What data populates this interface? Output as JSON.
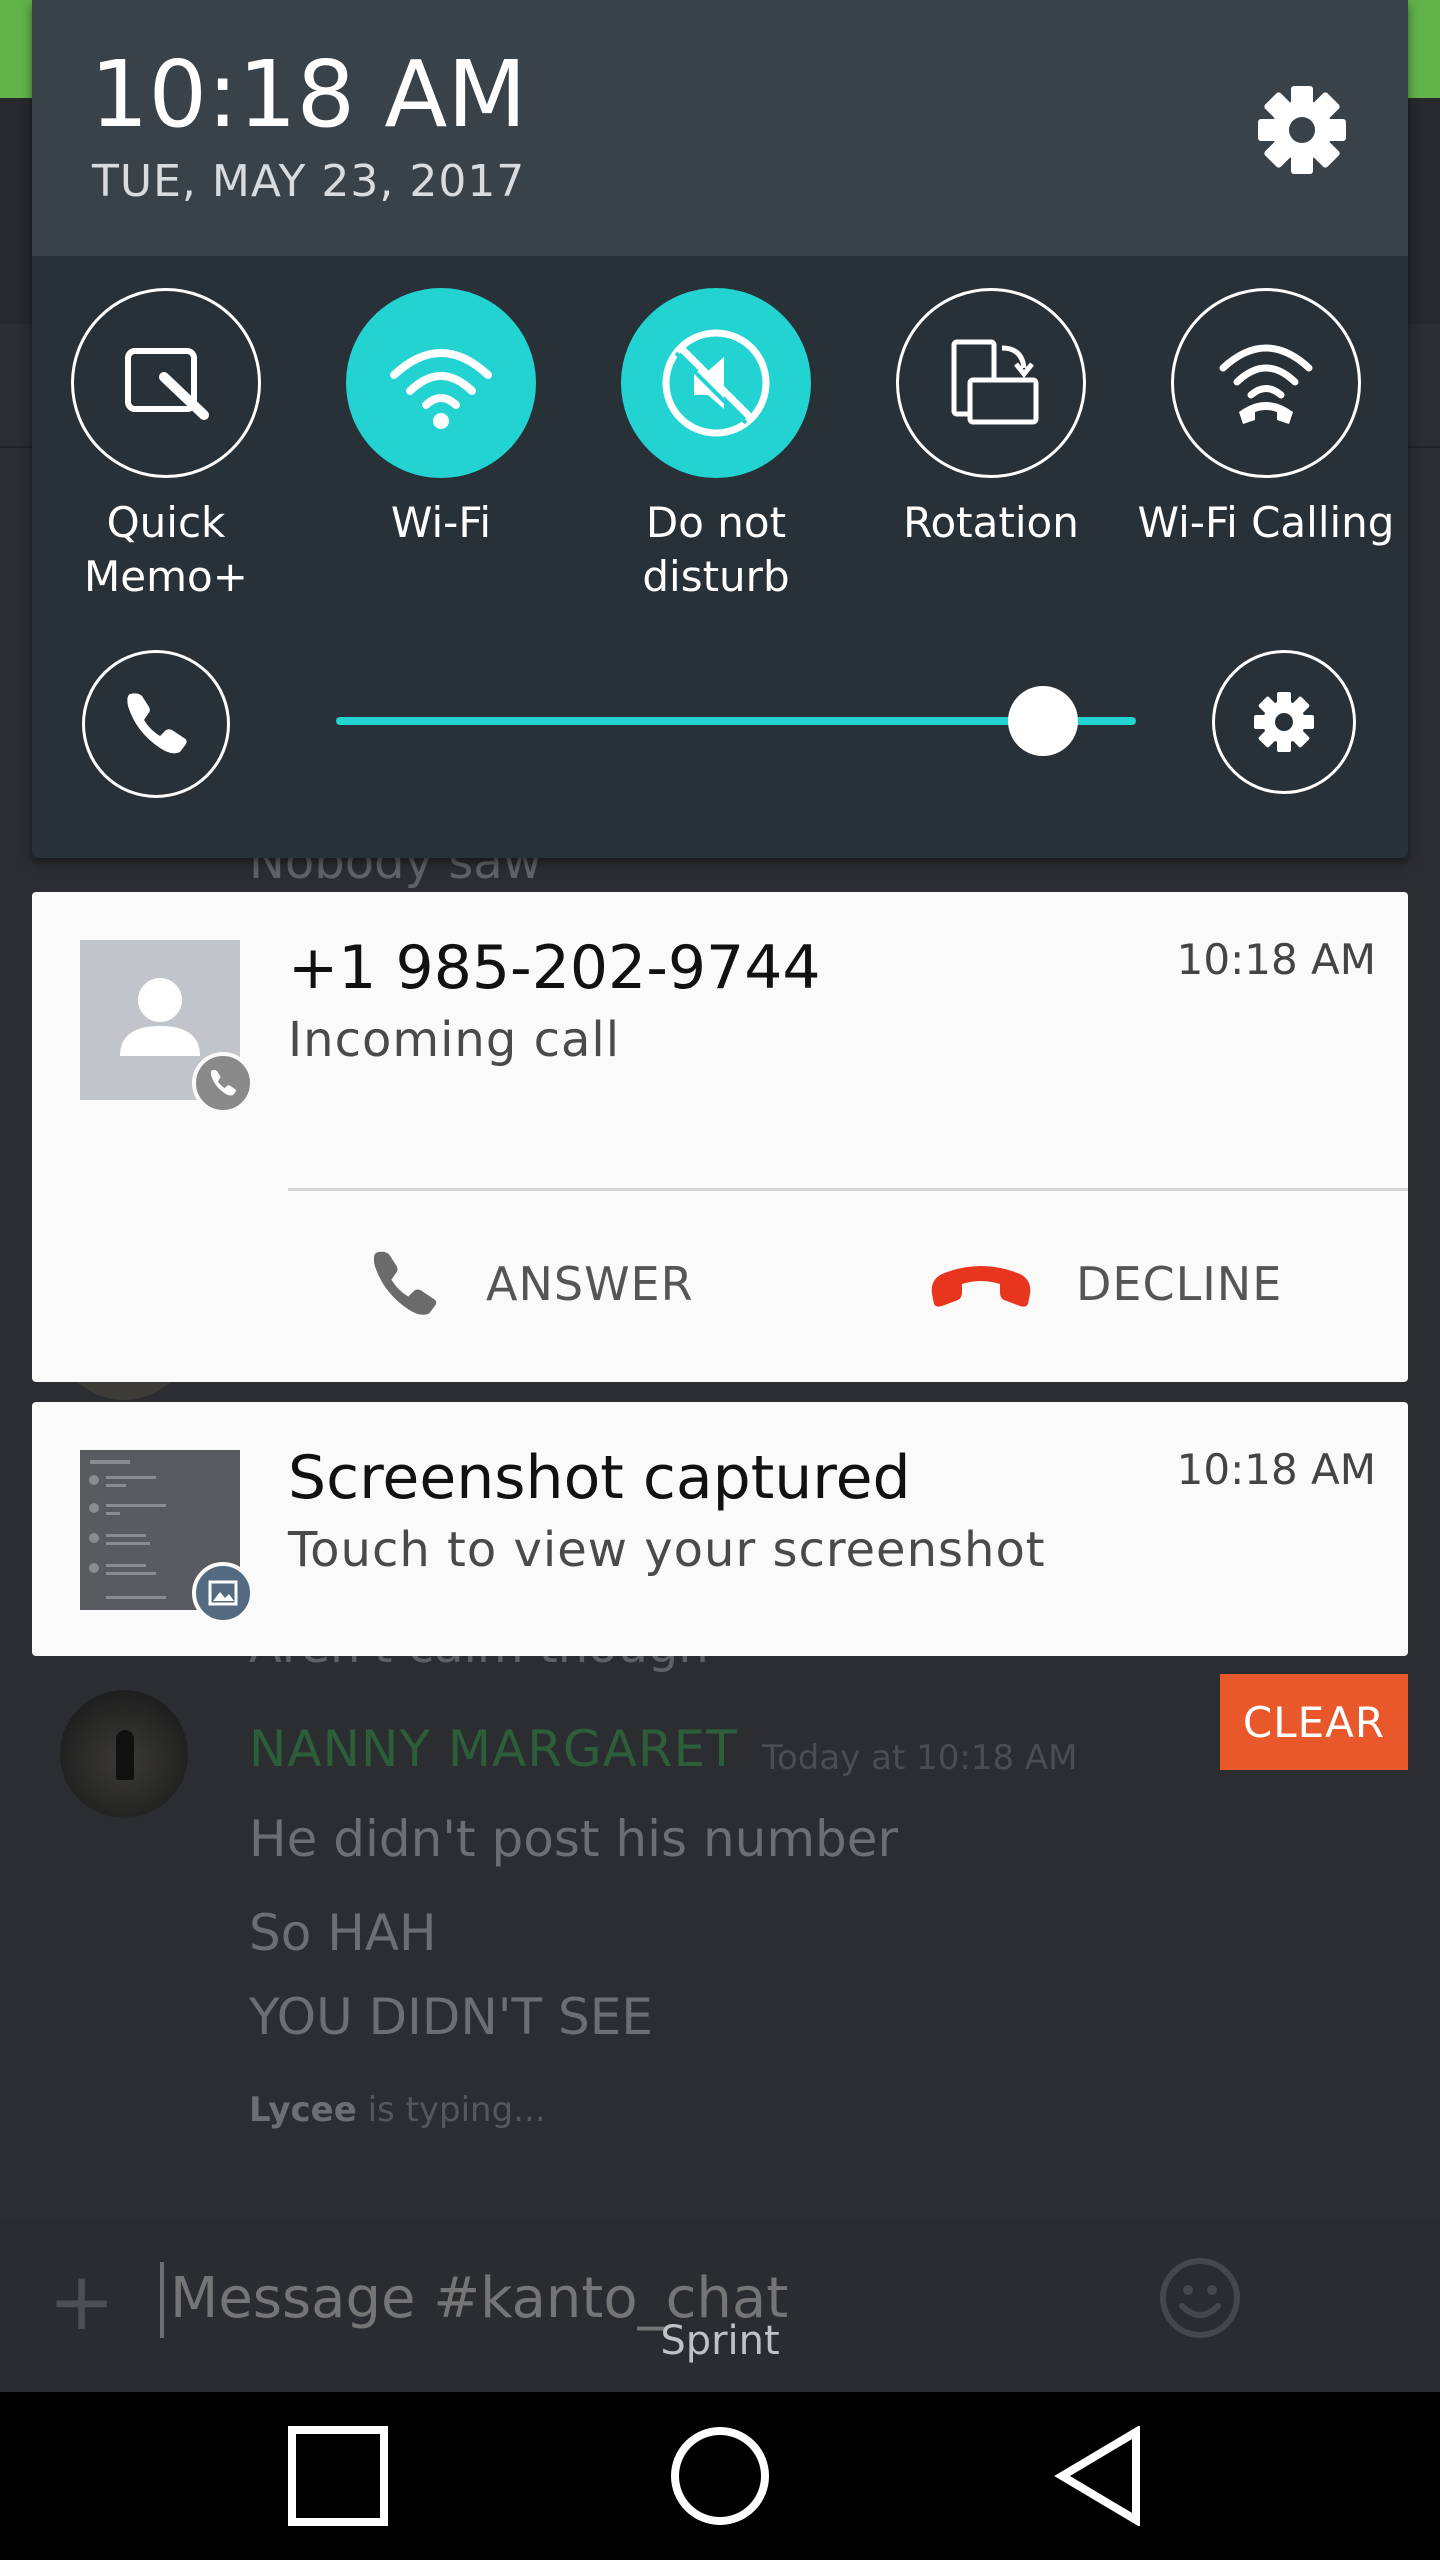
{
  "status": {
    "time": "10:18 AM",
    "date": "TUE, MAY 23, 2017"
  },
  "quick_settings": {
    "tiles": [
      {
        "label": "Quick\nMemo+",
        "icon": "quick-memo-icon",
        "active": false
      },
      {
        "label": "Wi-Fi",
        "icon": "wifi-icon",
        "active": true
      },
      {
        "label": "Do not\ndisturb",
        "icon": "do-not-disturb-icon",
        "active": true
      },
      {
        "label": "Rotation",
        "icon": "rotation-icon",
        "active": false
      },
      {
        "label": "Wi-Fi Calling",
        "icon": "wifi-calling-icon",
        "active": false
      }
    ],
    "brightness_level": 0.92
  },
  "notifications": {
    "call": {
      "title": "+1 985-202-9744",
      "subtitle": "Incoming call",
      "time": "10:18 AM",
      "answer_label": "ANSWER",
      "decline_label": "DECLINE"
    },
    "screenshot": {
      "title": "Screenshot captured",
      "subtitle": "Touch to view your screenshot",
      "time": "10:18 AM"
    },
    "clear_label": "CLEAR"
  },
  "background_chat": {
    "partial_line_top": "Nobody saw",
    "partial_line_bottom": "Aren't calm though",
    "username": "NANNY MARGARET",
    "timestamp": "Today at 10:18 AM",
    "messages": [
      "He didn't post his number",
      "So HAH",
      "YOU DIDN'T SEE"
    ],
    "typing_user": "Lycee",
    "typing_suffix": " is typing...",
    "input_placeholder": "Message #kanto_chat"
  },
  "carrier": "Sprint",
  "colors": {
    "accent": "#22d3d1",
    "decline": "#e8361e",
    "clear_button": "#e9582a",
    "username": "#2d5e3a"
  }
}
